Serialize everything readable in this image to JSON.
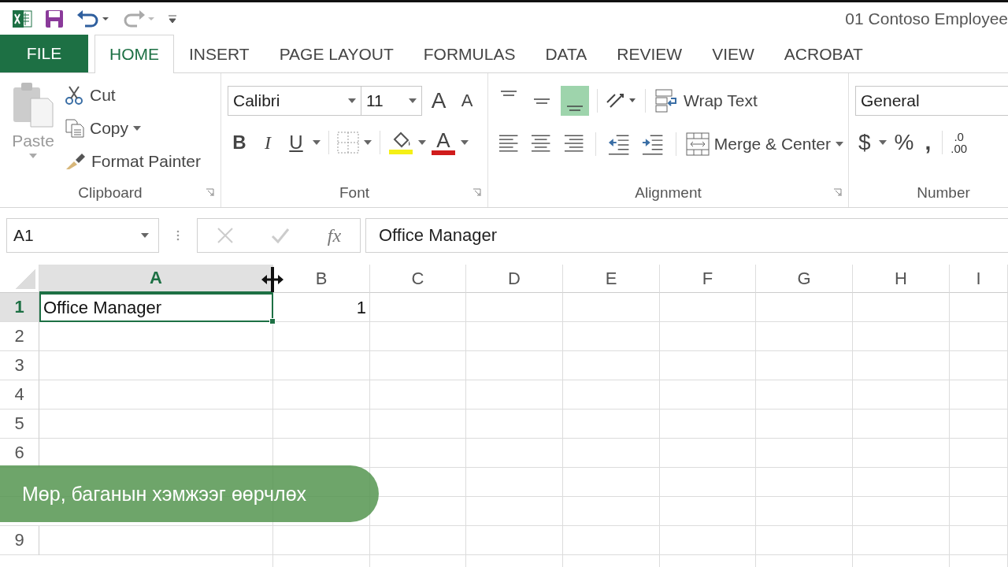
{
  "title_bar": {
    "title": "01 Contoso Employee"
  },
  "tabs": [
    {
      "label": "FILE",
      "kind": "file",
      "selected": false
    },
    {
      "label": "HOME",
      "kind": "tab",
      "selected": true
    },
    {
      "label": "INSERT",
      "kind": "tab",
      "selected": false
    },
    {
      "label": "PAGE LAYOUT",
      "kind": "tab",
      "selected": false
    },
    {
      "label": "FORMULAS",
      "kind": "tab",
      "selected": false
    },
    {
      "label": "DATA",
      "kind": "tab",
      "selected": false
    },
    {
      "label": "REVIEW",
      "kind": "tab",
      "selected": false
    },
    {
      "label": "VIEW",
      "kind": "tab",
      "selected": false
    },
    {
      "label": "ACROBAT",
      "kind": "tab",
      "selected": false
    }
  ],
  "clipboard": {
    "paste": "Paste",
    "items": [
      "Cut",
      "Copy",
      "Format Painter"
    ],
    "label": "Clipboard"
  },
  "font": {
    "name": "Calibri",
    "size": "11",
    "grow": "A",
    "shrink": "A",
    "bold": "B",
    "italic": "I",
    "underline": "U",
    "color_letter": "A",
    "label": "Font"
  },
  "alignment": {
    "vertical": [
      {
        "selected": false
      },
      {
        "selected": false
      },
      {
        "selected": true
      }
    ],
    "wrap": "Wrap Text",
    "merge": "Merge & Center",
    "label": "Alignment"
  },
  "number": {
    "format": "General",
    "currency": "$",
    "percent": "%",
    "comma": ",",
    "decimal_top": ".0",
    "decimal_bottom": ".00",
    "label": "Number"
  },
  "formula_bar": {
    "name_box": "A1",
    "fx": "fx",
    "value": "Office Manager"
  },
  "grid": {
    "columns": [
      {
        "label": "A",
        "selected": true
      },
      {
        "label": "B",
        "selected": false
      },
      {
        "label": "C",
        "selected": false
      },
      {
        "label": "D",
        "selected": false
      },
      {
        "label": "E",
        "selected": false
      },
      {
        "label": "F",
        "selected": false
      },
      {
        "label": "G",
        "selected": false
      },
      {
        "label": "H",
        "selected": false
      },
      {
        "label": "I",
        "selected": false
      }
    ],
    "rows": [
      {
        "label": "1",
        "selected": true,
        "cells": [
          {
            "text": "Office Manager",
            "kind": "text",
            "active": true
          },
          {
            "text": "1",
            "kind": "number",
            "active": false
          }
        ]
      },
      {
        "label": "2",
        "selected": false
      },
      {
        "label": "3",
        "selected": false
      },
      {
        "label": "4",
        "selected": false
      },
      {
        "label": "5",
        "selected": false
      },
      {
        "label": "6",
        "selected": false
      },
      {},
      {},
      {
        "label": "9",
        "selected": false
      }
    ]
  },
  "caption": "Мөр, баганын хэмжээг өөрчлөх"
}
